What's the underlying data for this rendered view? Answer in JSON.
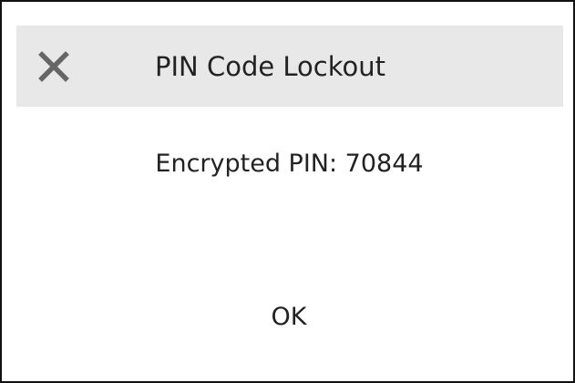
{
  "dialog": {
    "title": "PIN Code Lockout",
    "message": "Encrypted PIN: 70844",
    "ok_label": "OK",
    "close_icon": "close-icon",
    "colors": {
      "titlebar_background": "#e8e8e8",
      "icon": "#666666",
      "text": "#222222",
      "border": "#111111"
    }
  }
}
